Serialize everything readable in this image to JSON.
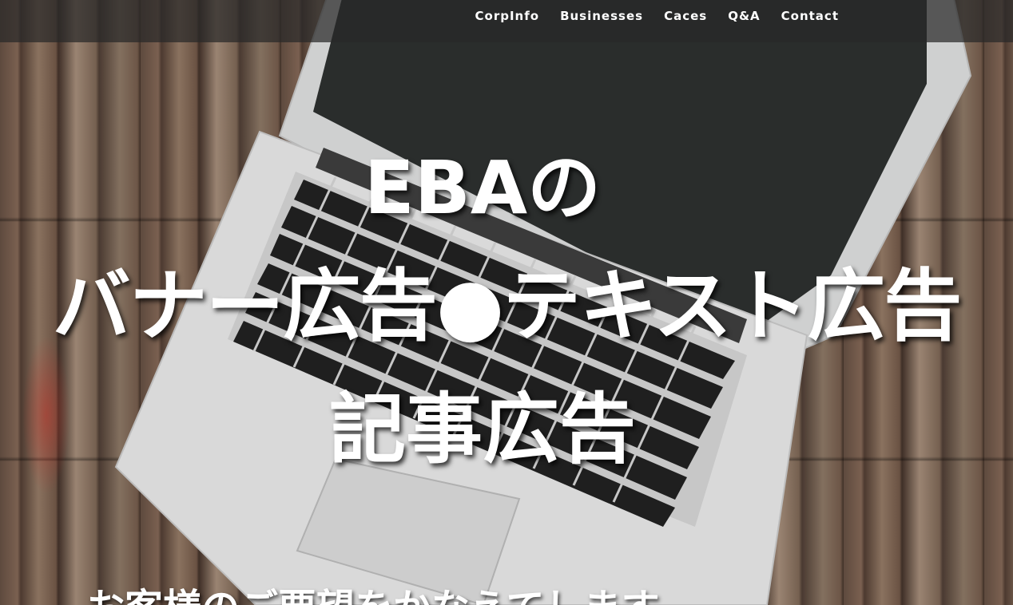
{
  "nav": {
    "items": [
      {
        "label": "CorpInfo"
      },
      {
        "label": "Businesses"
      },
      {
        "label": "Caces"
      },
      {
        "label": "Q&A"
      },
      {
        "label": "Contact"
      }
    ]
  },
  "hero": {
    "line1": "EBAの",
    "line2": "バナー広告●テキスト広告",
    "line3": "記事広告",
    "subtitle": "お客様のご要望をかなえてします"
  },
  "background": {
    "image_subject": "laptop on wooden floor",
    "screen_color": "#2a2d2c",
    "body_color": "#d8d8d8"
  }
}
